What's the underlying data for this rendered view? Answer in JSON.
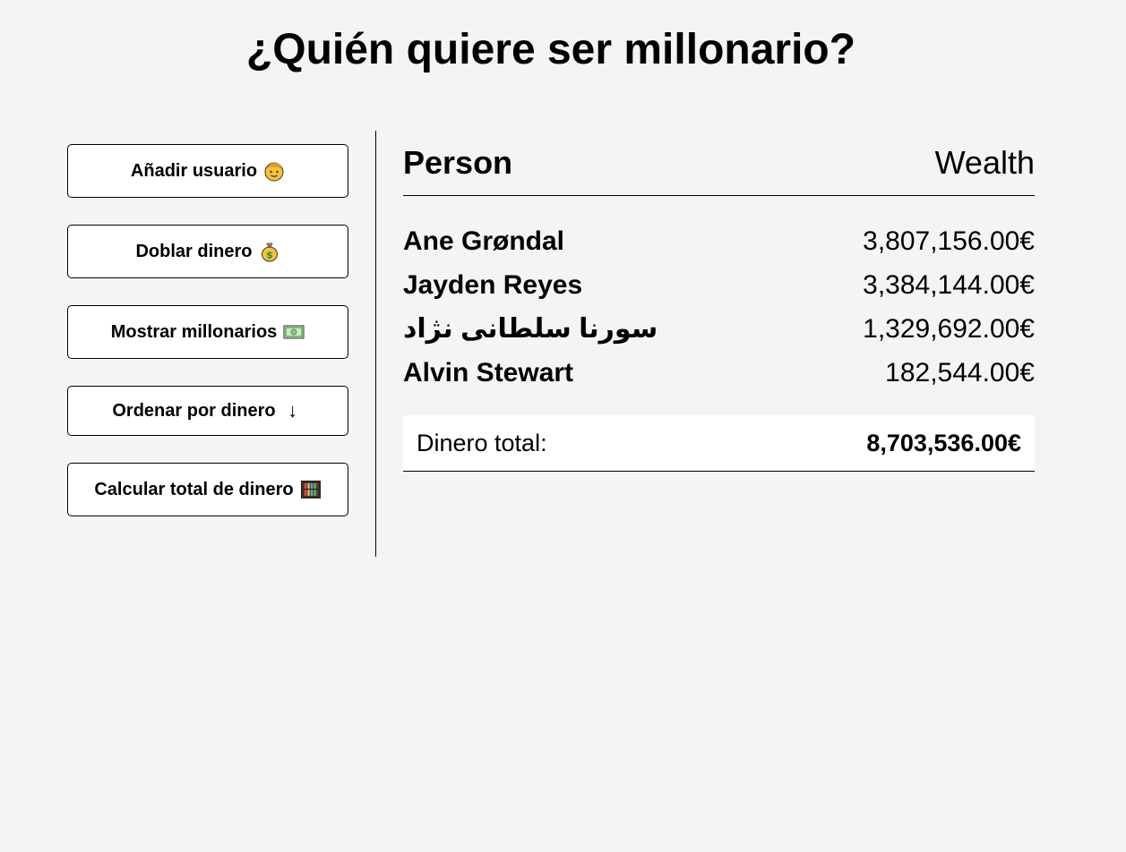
{
  "page": {
    "title": "¿Quién quiere ser millonario?"
  },
  "sidebar": {
    "buttons": [
      {
        "label": "Añadir usuario",
        "icon": "boy-face-icon"
      },
      {
        "label": "Doblar dinero",
        "icon": "money-bag-icon"
      },
      {
        "label": "Mostrar millonarios",
        "icon": "banknote-icon"
      },
      {
        "label": "Ordenar por dinero",
        "icon": "↓"
      },
      {
        "label": "Calcular total de dinero",
        "icon": "abacus-icon"
      }
    ]
  },
  "table": {
    "headers": {
      "person": "Person",
      "wealth": "Wealth"
    },
    "rows": [
      {
        "name": "Ane Grøndal",
        "wealth": "3,807,156.00€"
      },
      {
        "name": "Jayden Reyes",
        "wealth": "3,384,144.00€"
      },
      {
        "name": "سورنا سلطانی نژاد",
        "wealth": "1,329,692.00€"
      },
      {
        "name": "Alvin Stewart",
        "wealth": "182,544.00€"
      }
    ],
    "total": {
      "label": "Dinero total:",
      "value": "8,703,536.00€"
    }
  },
  "colors": {
    "background": "#f4f4f4",
    "button_bg": "#ffffff",
    "border": "#000000",
    "emoji_yellow": "#f5c335",
    "money_green": "#2e8b3d"
  }
}
